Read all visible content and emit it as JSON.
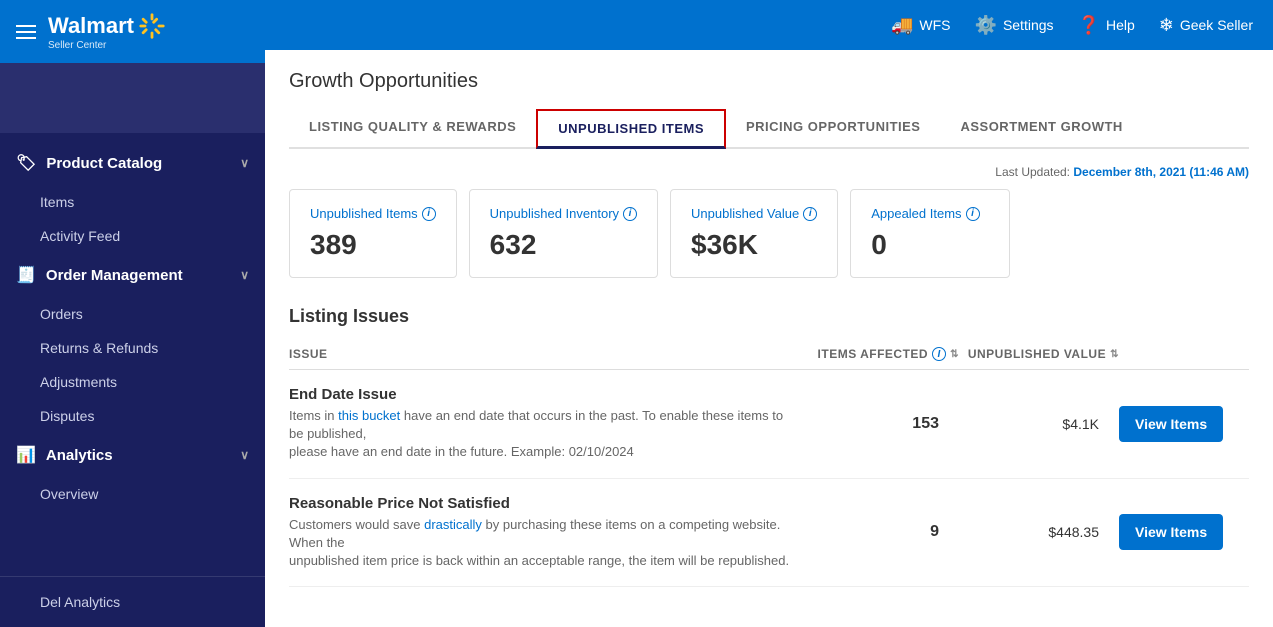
{
  "sidebar": {
    "logo_text": "Walmart",
    "logo_sub": "Seller Center",
    "sections": [
      {
        "id": "product-catalog",
        "icon": "🏷",
        "label": "Product Catalog",
        "expanded": true,
        "sub_items": [
          {
            "id": "items",
            "label": "Items",
            "active": false
          },
          {
            "id": "activity-feed",
            "label": "Activity Feed",
            "active": false
          }
        ]
      },
      {
        "id": "order-management",
        "icon": "🧾",
        "label": "Order Management",
        "expanded": true,
        "sub_items": [
          {
            "id": "orders",
            "label": "Orders",
            "active": false
          },
          {
            "id": "returns-refunds",
            "label": "Returns & Refunds",
            "active": false
          },
          {
            "id": "adjustments",
            "label": "Adjustments",
            "active": false
          },
          {
            "id": "disputes",
            "label": "Disputes",
            "active": false
          }
        ]
      },
      {
        "id": "analytics",
        "icon": "📊",
        "label": "Analytics",
        "expanded": true,
        "sub_items": [
          {
            "id": "overview",
            "label": "Overview",
            "active": false
          }
        ]
      }
    ],
    "bottom_items": [
      {
        "id": "del-analytics",
        "label": "Del Analytics"
      }
    ]
  },
  "topnav": {
    "items": [
      {
        "id": "wfs",
        "icon": "🚚",
        "label": "WFS"
      },
      {
        "id": "settings",
        "icon": "⚙️",
        "label": "Settings"
      },
      {
        "id": "help",
        "icon": "❓",
        "label": "Help"
      },
      {
        "id": "user",
        "icon": "❄",
        "label": "Geek Seller"
      }
    ]
  },
  "page": {
    "title": "Growth Opportunities",
    "tabs": [
      {
        "id": "listing-quality",
        "label": "LISTING QUALITY & REWARDS",
        "active": false
      },
      {
        "id": "unpublished-items",
        "label": "UNPUBLISHED ITEMS",
        "active": true
      },
      {
        "id": "pricing-opportunities",
        "label": "PRICING OPPORTUNITIES",
        "active": false
      },
      {
        "id": "assortment-growth",
        "label": "ASSORTMENT GROWTH",
        "active": false
      }
    ],
    "last_updated_label": "Last Updated:",
    "last_updated_value": "December 8th, 2021 (11:46 AM)",
    "stat_cards": [
      {
        "id": "unpublished-items",
        "label": "Unpublished Items",
        "value": "389",
        "is_link": false
      },
      {
        "id": "unpublished-inventory",
        "label": "Unpublished Inventory",
        "value": "632",
        "is_link": false
      },
      {
        "id": "unpublished-value",
        "label": "Unpublished Value",
        "value": "$36K",
        "is_link": false
      },
      {
        "id": "appealed-items",
        "label": "Appealed Items",
        "value": "0",
        "is_link": true
      }
    ],
    "listing_issues": {
      "title": "Listing Issues",
      "table_headers": {
        "issue": "ISSUE",
        "items_affected": "ITEMS AFFECTED",
        "unpublished_value": "UNPUBLISHED VALUE"
      },
      "rows": [
        {
          "id": "end-date-issue",
          "title": "End Date Issue",
          "description_parts": [
            {
              "text": "Items in ",
              "highlight": false
            },
            {
              "text": "this bucket",
              "highlight": true
            },
            {
              "text": " have an end date that occurs in the past. To enable these items to be published,",
              "highlight": false
            }
          ],
          "description_line2": "please have an end date in the future. Example: 02/10/2024",
          "items_affected": "153",
          "unpublished_value": "$4.1K",
          "btn_label": "View Items"
        },
        {
          "id": "reasonable-price",
          "title": "Reasonable Price Not Satisfied",
          "description_parts": [
            {
              "text": "Customers would save ",
              "highlight": false
            },
            {
              "text": "drastically",
              "highlight": true
            },
            {
              "text": " by purchasing these items on a competing website. When the",
              "highlight": false
            }
          ],
          "description_line2": "unpublished item price is back within an acceptable range, the item will be republished.",
          "items_affected": "9",
          "unpublished_value": "$448.35",
          "btn_label": "View Items"
        }
      ]
    }
  }
}
